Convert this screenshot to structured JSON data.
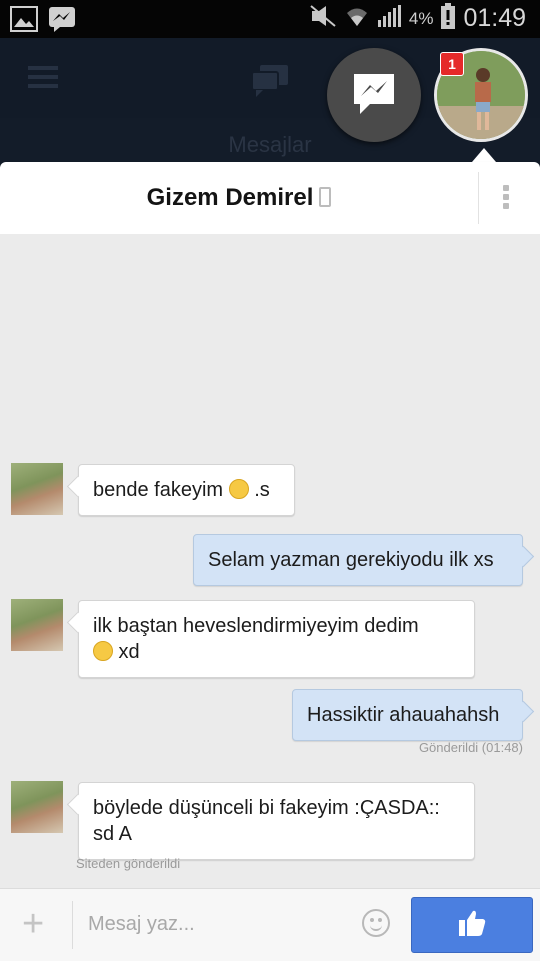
{
  "status_bar": {
    "battery_percent": "4%",
    "time": "01:49",
    "icons": [
      "image-icon",
      "messenger-notification-icon",
      "mute-icon",
      "wifi-icon",
      "signal-icon",
      "battery-alert-icon"
    ]
  },
  "background_app": {
    "section_label": "Mesajlar"
  },
  "chat_heads": {
    "badge_count": "1"
  },
  "chat": {
    "contact_name": "Gizem Demirel",
    "messages": [
      {
        "direction": "in",
        "text": "bende fakeyim",
        "suffix": " .s",
        "emoji": "surprised-emoji"
      },
      {
        "direction": "out",
        "text": "Selam yazman gerekiyodu ilk xs"
      },
      {
        "direction": "in",
        "line1": "ilk baştan heveslendirmiyeyim dedim",
        "line2": " xd",
        "emoji": "smile-emoji"
      },
      {
        "direction": "out",
        "text": "Hassiktir ahauahahsh"
      },
      {
        "direction": "in",
        "line1": "böylede düşünceli bi fakeyim :ÇASDA::",
        "line2": "sd A"
      }
    ],
    "sent_status": "Gönderildi (01:48)",
    "source_note": "Siteden gönderildi"
  },
  "composer": {
    "plus_label": "+",
    "placeholder": "Mesaj yaz..."
  },
  "colors": {
    "outgoing_bubble": "#d3e3f6",
    "incoming_bubble": "#ffffff",
    "like_button": "#4b7fe0",
    "badge": "#e52a2a"
  }
}
